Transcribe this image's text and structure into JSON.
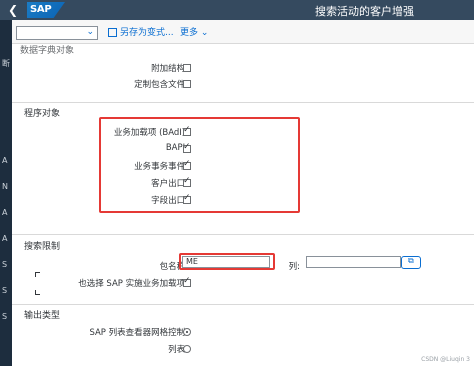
{
  "shell": {
    "back_icon": "chevron-left-icon",
    "logo_text": "SAP",
    "title": "搜索活动的客户增强"
  },
  "leftstrip": {
    "letters": [
      "断",
      "A",
      "N",
      "A",
      "A",
      "S",
      "S",
      "S"
    ]
  },
  "toolbar": {
    "variant_value": "",
    "save_as_variant_label": "另存为变式...",
    "more_label": "更多"
  },
  "sections": {
    "partial_title": "数据字典对象",
    "program_objects_title": "程序对象",
    "search_restrictions_title": "搜索限制",
    "output_type_title": "输出类型"
  },
  "dictionary_objects": [
    {
      "label": "附加结构:",
      "checked": false
    },
    {
      "label": "定制包含文件:",
      "checked": false
    }
  ],
  "program_objects": [
    {
      "label": "业务加载项 (BAdI):",
      "checked": true
    },
    {
      "label": "BAPI:",
      "checked": true
    },
    {
      "label": "业务事务事件:",
      "checked": true
    },
    {
      "label": "客户出口:",
      "checked": true
    },
    {
      "label": "字段出口:",
      "checked": true
    }
  ],
  "search": {
    "package_label": "包名称:",
    "package_value": "ME",
    "column_label": "列:",
    "column_value": "",
    "sap_badi_label": "也选择 SAP 实施业务加载项:",
    "sap_badi_checked": true
  },
  "output": {
    "options": [
      {
        "label": "SAP 列表查看器网格控制:",
        "selected": true
      },
      {
        "label": "列表:",
        "selected": false
      }
    ]
  },
  "watermark": "CSDN @Liuqin 3",
  "colors": {
    "shell_bg": "#354a5f",
    "highlight": "#e53935",
    "accent": "#0a6ed1"
  }
}
